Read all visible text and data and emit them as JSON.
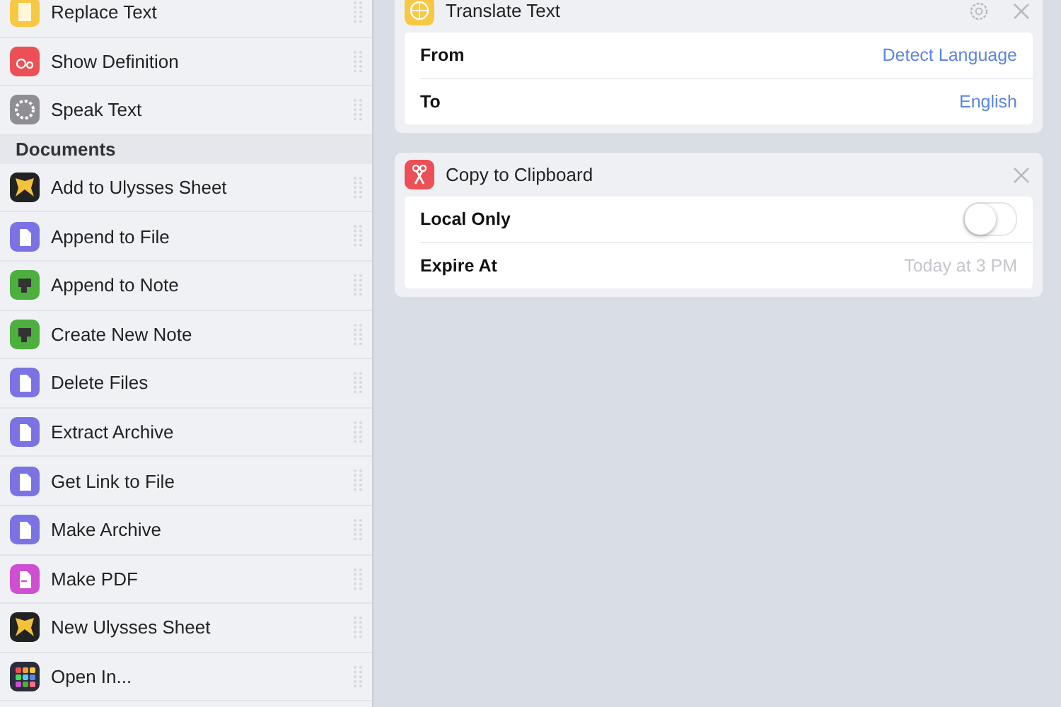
{
  "sidebar": {
    "items": [
      {
        "kind": "action",
        "label": "Replace Text"
      },
      {
        "kind": "action",
        "label": "Show Definition"
      },
      {
        "kind": "action",
        "label": "Speak Text"
      },
      {
        "kind": "section",
        "label": "Documents"
      },
      {
        "kind": "action",
        "label": "Add to Ulysses Sheet"
      },
      {
        "kind": "action",
        "label": "Append to File"
      },
      {
        "kind": "action",
        "label": "Append to Note"
      },
      {
        "kind": "action",
        "label": "Create New Note"
      },
      {
        "kind": "action",
        "label": "Delete Files"
      },
      {
        "kind": "action",
        "label": "Extract Archive"
      },
      {
        "kind": "action",
        "label": "Get Link to File"
      },
      {
        "kind": "action",
        "label": "Make Archive"
      },
      {
        "kind": "action",
        "label": "Make PDF"
      },
      {
        "kind": "action",
        "label": "New Ulysses Sheet"
      },
      {
        "kind": "action",
        "label": "Open In..."
      }
    ]
  },
  "actions": [
    {
      "title": "Translate Text",
      "settings": true,
      "rows": [
        {
          "kind": "value",
          "label": "From",
          "value": "Detect Language"
        },
        {
          "kind": "value",
          "label": "To",
          "value": "English"
        }
      ]
    },
    {
      "title": "Copy to Clipboard",
      "settings": false,
      "rows": [
        {
          "kind": "toggle",
          "label": "Local Only",
          "on": false
        },
        {
          "kind": "value",
          "label": "Expire At",
          "placeholder": "Today at 3 PM"
        }
      ]
    }
  ]
}
